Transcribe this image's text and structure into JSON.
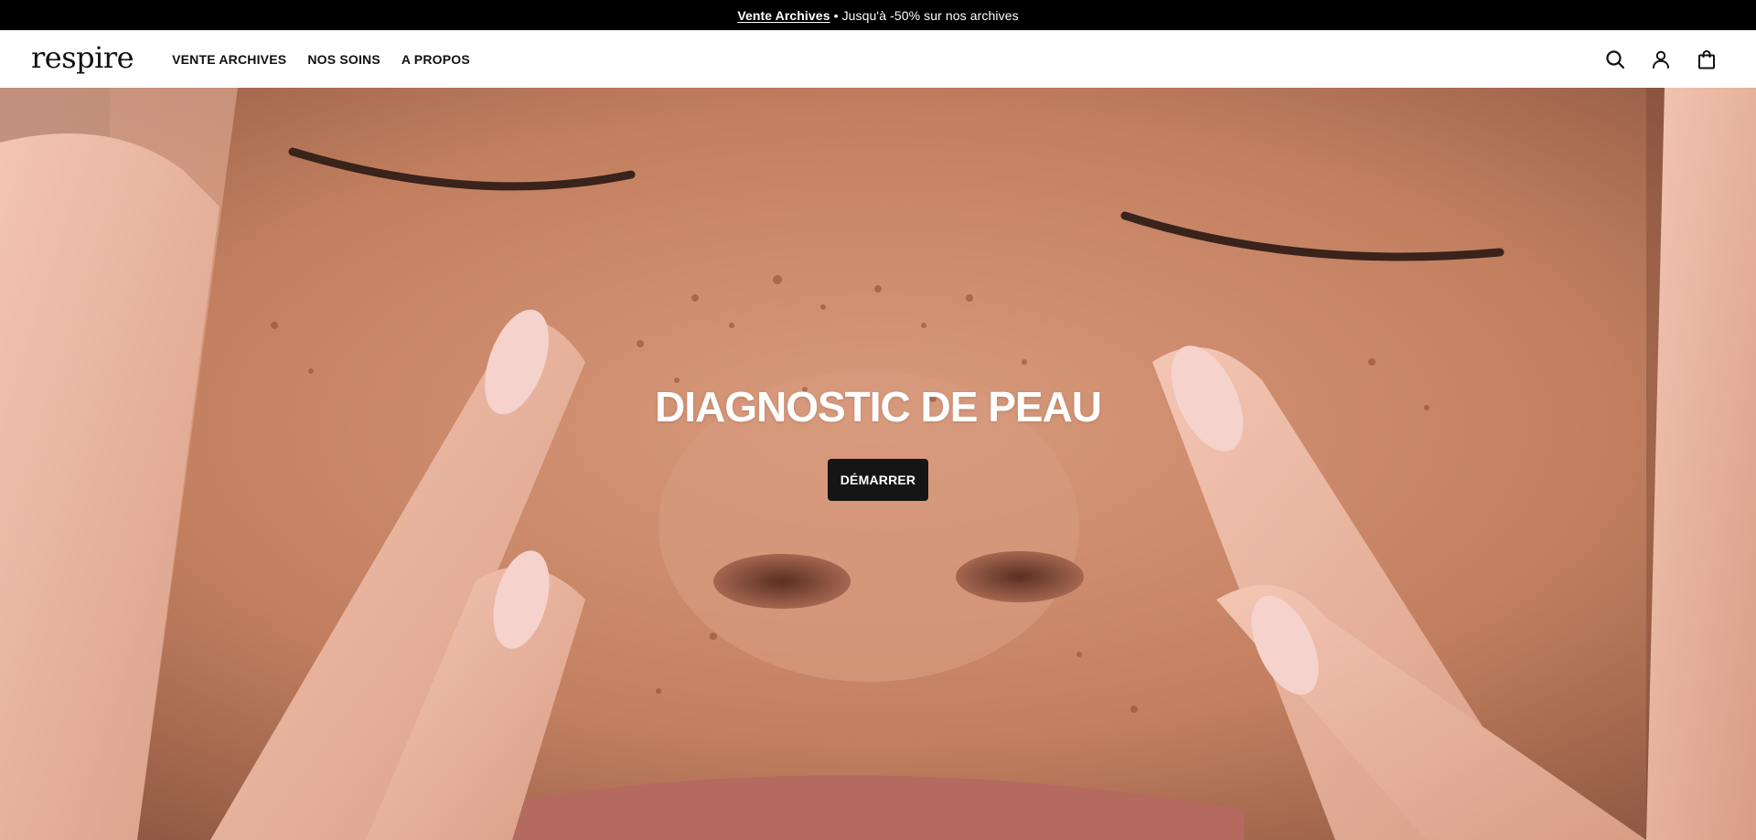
{
  "announcement": {
    "link_text": "Vente Archives",
    "text": " • Jusqu'à -50% sur nos archives"
  },
  "header": {
    "logo": "respire",
    "nav": [
      {
        "label": "VENTE ARCHIVES"
      },
      {
        "label": "NOS SOINS"
      },
      {
        "label": "A PROPOS"
      }
    ],
    "icons": [
      "search-icon",
      "account-icon",
      "bag-icon"
    ]
  },
  "hero": {
    "title": "DIAGNOSTIC DE PEAU",
    "button_label": "DÉMARRER"
  },
  "colors": {
    "announcement_bg": "#000000",
    "button_bg": "#151515",
    "text_dark": "#111111"
  }
}
